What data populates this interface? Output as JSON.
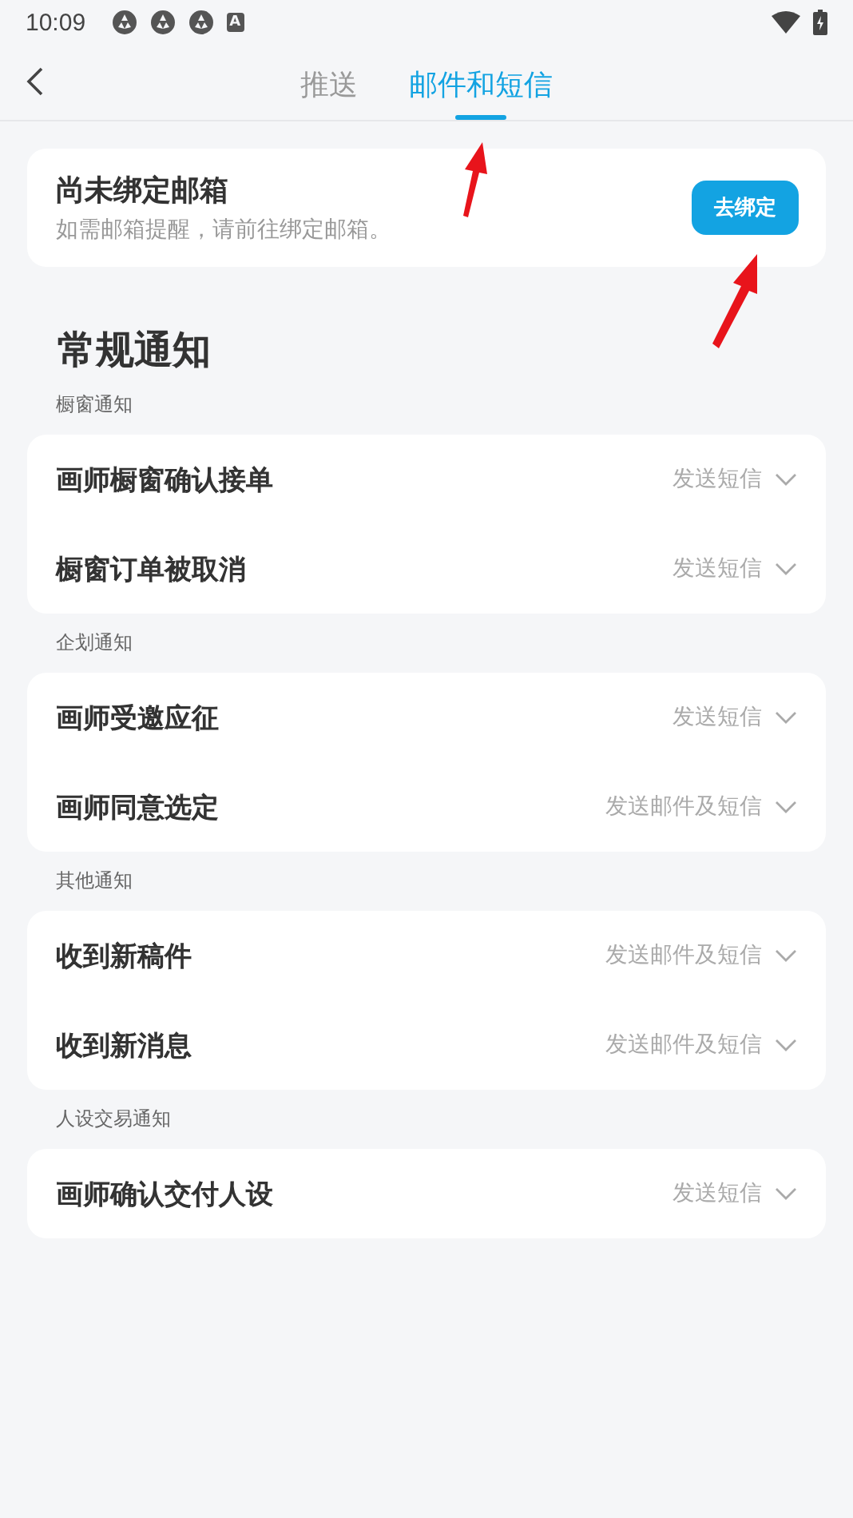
{
  "status_bar": {
    "time": "10:09",
    "badge": "A"
  },
  "tabs": [
    {
      "label": "推送",
      "selected": false
    },
    {
      "label": "邮件和短信",
      "selected": true
    }
  ],
  "bind_card": {
    "title": "尚未绑定邮箱",
    "subtitle": "如需邮箱提醒，请前往绑定邮箱。",
    "button": "去绑定"
  },
  "section_title": "常规通知",
  "groups": [
    {
      "label": "橱窗通知",
      "items": [
        {
          "name": "画师橱窗确认接单",
          "value": "发送短信"
        },
        {
          "name": "橱窗订单被取消",
          "value": "发送短信"
        }
      ]
    },
    {
      "label": "企划通知",
      "items": [
        {
          "name": "画师受邀应征",
          "value": "发送短信"
        },
        {
          "name": "画师同意选定",
          "value": "发送邮件及短信"
        }
      ]
    },
    {
      "label": "其他通知",
      "items": [
        {
          "name": "收到新稿件",
          "value": "发送邮件及短信"
        },
        {
          "name": "收到新消息",
          "value": "发送邮件及短信"
        }
      ]
    },
    {
      "label": "人设交易通知",
      "items": [
        {
          "name": "画师确认交付人设",
          "value": "发送短信"
        }
      ]
    }
  ]
}
